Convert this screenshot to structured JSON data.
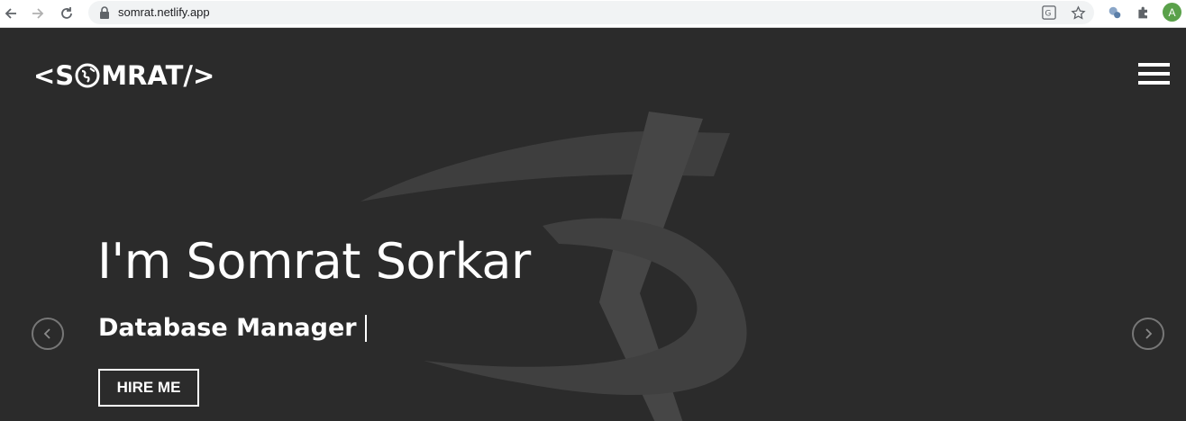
{
  "browser": {
    "url": "somrat.netlify.app",
    "avatar_letter": "A",
    "icons": [
      "back-arrow-icon",
      "forward-arrow-icon",
      "reload-icon",
      "lock-icon",
      "translate-icon",
      "star-icon",
      "extension-icon",
      "puzzle-icon"
    ]
  },
  "page": {
    "brand_left": "<S",
    "brand_right": "MRAT/>",
    "headline": "I'm Somrat Sorkar",
    "subline": "Database Manager",
    "hire_label": "HIRE ME",
    "colors": {
      "background": "#2b2b2b",
      "text": "#ffffff",
      "watermark": "#4a4a4a"
    }
  }
}
